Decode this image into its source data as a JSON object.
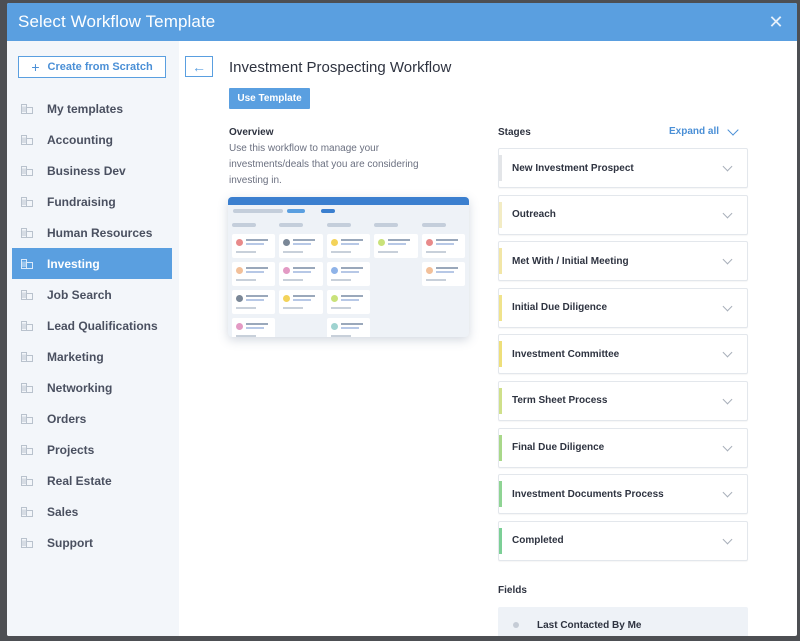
{
  "modal": {
    "title": "Select Workflow Template",
    "close_icon": "close-icon"
  },
  "sidebar": {
    "create_button": {
      "icon": "plus-icon",
      "label": "Create from Scratch"
    },
    "items": [
      {
        "label": "My templates",
        "icon": "folder-building-icon",
        "active": false
      },
      {
        "label": "Accounting",
        "icon": "folder-building-icon",
        "active": false
      },
      {
        "label": "Business Dev",
        "icon": "folder-building-icon",
        "active": false
      },
      {
        "label": "Fundraising",
        "icon": "folder-building-icon",
        "active": false
      },
      {
        "label": "Human Resources",
        "icon": "folder-building-icon",
        "active": false
      },
      {
        "label": "Investing",
        "icon": "folder-building-icon",
        "active": true
      },
      {
        "label": "Job Search",
        "icon": "folder-building-icon",
        "active": false
      },
      {
        "label": "Lead Qualifications",
        "icon": "folder-building-icon",
        "active": false
      },
      {
        "label": "Marketing",
        "icon": "folder-building-icon",
        "active": false
      },
      {
        "label": "Networking",
        "icon": "folder-building-icon",
        "active": false
      },
      {
        "label": "Orders",
        "icon": "folder-building-icon",
        "active": false
      },
      {
        "label": "Projects",
        "icon": "folder-building-icon",
        "active": false
      },
      {
        "label": "Real Estate",
        "icon": "folder-building-icon",
        "active": false
      },
      {
        "label": "Sales",
        "icon": "folder-building-icon",
        "active": false
      },
      {
        "label": "Support",
        "icon": "folder-building-icon",
        "active": false
      }
    ]
  },
  "main": {
    "back_icon": "arrow-left-icon",
    "title": "Investment Prospecting Workflow",
    "use_template_label": "Use Template",
    "overview": {
      "heading": "Overview",
      "text": "Use this workflow to manage your investments/deals that you are considering investing in."
    },
    "preview_image": "workflow-board-preview",
    "stages": {
      "heading": "Stages",
      "expand_all_label": "Expand all",
      "items": [
        {
          "label": "New Investment Prospect",
          "color": "#e3e5e8"
        },
        {
          "label": "Outreach",
          "color": "#f3ecc4"
        },
        {
          "label": "Met With / Initial Meeting",
          "color": "#f2e6a6"
        },
        {
          "label": "Initial Due Diligence",
          "color": "#f0e38c"
        },
        {
          "label": "Investment Committee",
          "color": "#eedf7a"
        },
        {
          "label": "Term Sheet Process",
          "color": "#cfe08a"
        },
        {
          "label": "Final Due Diligence",
          "color": "#a9d88a"
        },
        {
          "label": "Investment Documents Process",
          "color": "#8fd494"
        },
        {
          "label": "Completed",
          "color": "#7ccf96"
        }
      ]
    },
    "fields": {
      "heading": "Fields",
      "items": [
        {
          "label": "Last Contacted By Me"
        }
      ]
    }
  },
  "colors": {
    "accent": "#5a9fe0",
    "sidebar_bg": "#f3f6fa",
    "text_dark": "#2e3340"
  }
}
